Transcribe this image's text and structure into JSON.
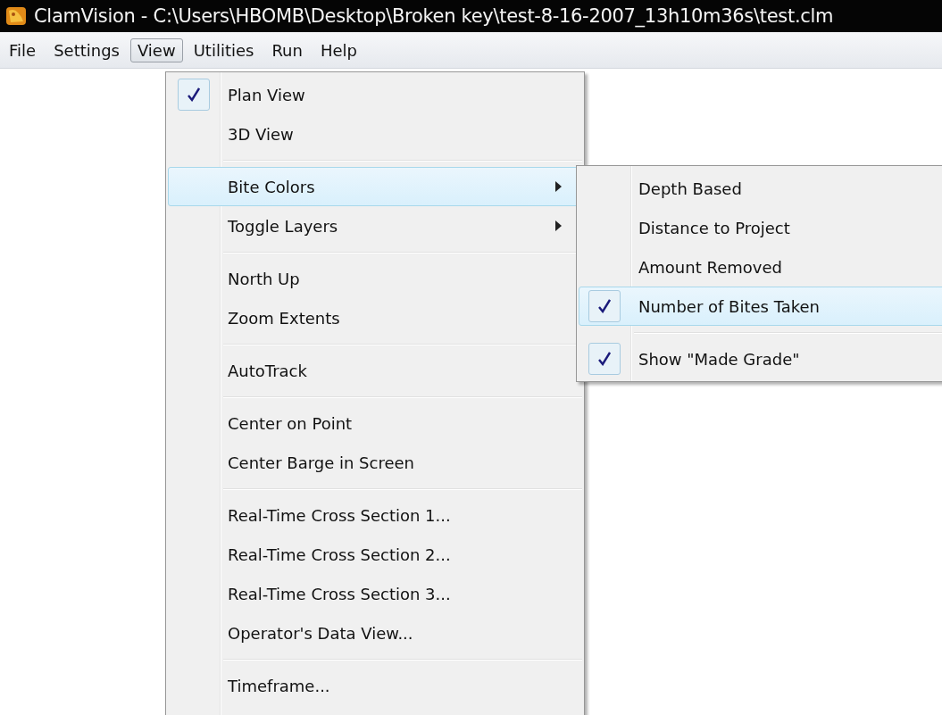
{
  "window": {
    "title": "ClamVision - C:\\Users\\HBOMB\\Desktop\\Broken key\\test-8-16-2007_13h10m36s\\test.clm"
  },
  "menu_bar": [
    {
      "label": "File",
      "selected": false
    },
    {
      "label": "Settings",
      "selected": false
    },
    {
      "label": "View",
      "selected": true
    },
    {
      "label": "Utilities",
      "selected": false
    },
    {
      "label": "Run",
      "selected": false
    },
    {
      "label": "Help",
      "selected": false
    }
  ],
  "view_menu": [
    {
      "kind": "item",
      "label": "Plan View",
      "checked": true,
      "selected": false,
      "submenu": false
    },
    {
      "kind": "item",
      "label": "3D View",
      "checked": false,
      "selected": false,
      "submenu": false
    },
    {
      "kind": "separator"
    },
    {
      "kind": "item",
      "label": "Bite Colors",
      "checked": false,
      "selected": true,
      "submenu": true
    },
    {
      "kind": "item",
      "label": "Toggle Layers",
      "checked": false,
      "selected": false,
      "submenu": true
    },
    {
      "kind": "separator"
    },
    {
      "kind": "item",
      "label": "North Up",
      "checked": false,
      "selected": false,
      "submenu": false
    },
    {
      "kind": "item",
      "label": "Zoom Extents",
      "checked": false,
      "selected": false,
      "submenu": false
    },
    {
      "kind": "separator"
    },
    {
      "kind": "item",
      "label": "AutoTrack",
      "checked": false,
      "selected": false,
      "submenu": false
    },
    {
      "kind": "separator"
    },
    {
      "kind": "item",
      "label": "Center on Point",
      "checked": false,
      "selected": false,
      "submenu": false
    },
    {
      "kind": "item",
      "label": "Center Barge in Screen",
      "checked": false,
      "selected": false,
      "submenu": false
    },
    {
      "kind": "separator"
    },
    {
      "kind": "item",
      "label": "Real-Time Cross Section 1...",
      "checked": false,
      "selected": false,
      "submenu": false
    },
    {
      "kind": "item",
      "label": "Real-Time Cross Section 2...",
      "checked": false,
      "selected": false,
      "submenu": false
    },
    {
      "kind": "item",
      "label": "Real-Time Cross Section 3...",
      "checked": false,
      "selected": false,
      "submenu": false
    },
    {
      "kind": "item",
      "label": "Operator's Data View...",
      "checked": false,
      "selected": false,
      "submenu": false
    },
    {
      "kind": "separator"
    },
    {
      "kind": "item",
      "label": "Timeframe...",
      "checked": false,
      "selected": false,
      "submenu": false
    }
  ],
  "bite_colors_submenu": [
    {
      "kind": "item",
      "label": "Depth Based",
      "checked": false,
      "selected": false,
      "submenu": false
    },
    {
      "kind": "item",
      "label": "Distance to Project",
      "checked": false,
      "selected": false,
      "submenu": false
    },
    {
      "kind": "item",
      "label": "Amount Removed",
      "checked": false,
      "selected": false,
      "submenu": false
    },
    {
      "kind": "item",
      "label": "Number of Bites Taken",
      "checked": true,
      "selected": true,
      "submenu": false
    },
    {
      "kind": "separator"
    },
    {
      "kind": "item",
      "label": "Show \"Made Grade\"",
      "checked": true,
      "selected": false,
      "submenu": false
    }
  ]
}
